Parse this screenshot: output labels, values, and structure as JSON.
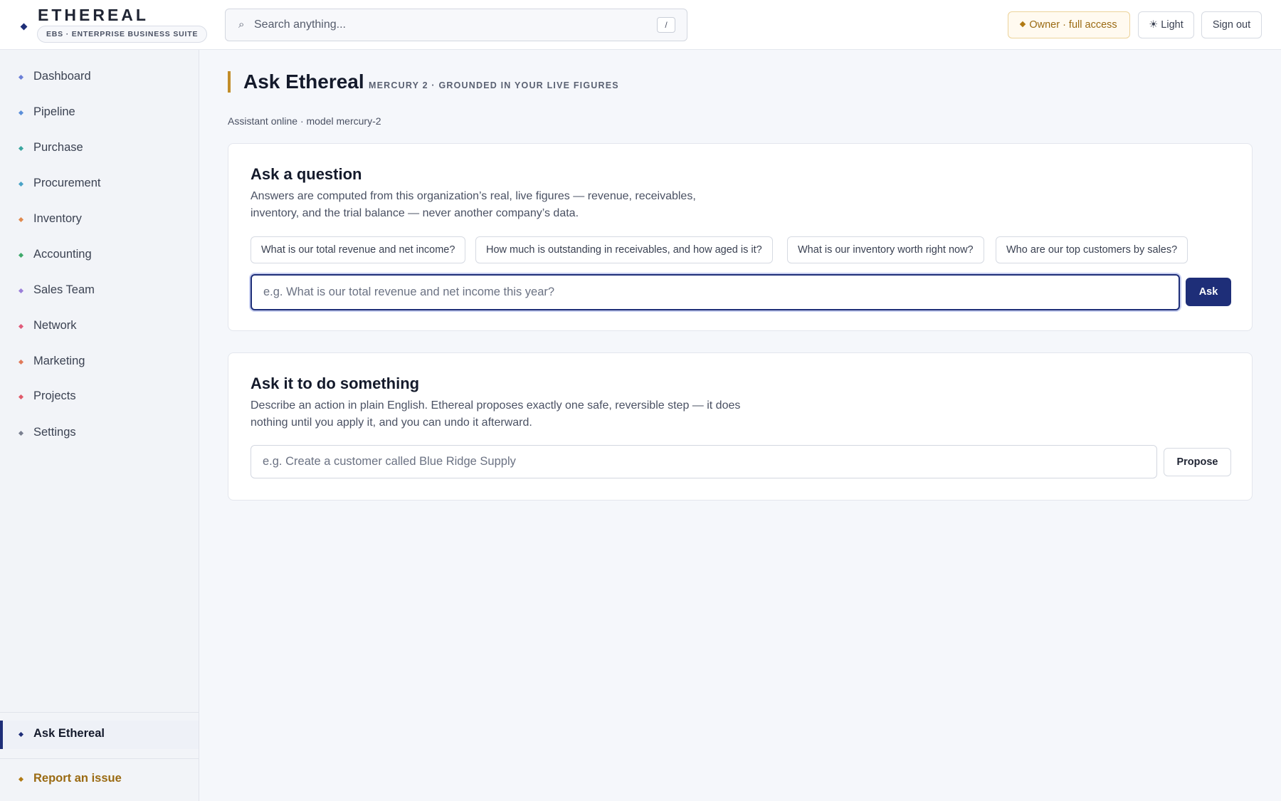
{
  "brand": {
    "name": "ETHEREAL",
    "tagline": "EBS · ENTERPRISE BUSINESS SUITE"
  },
  "search": {
    "placeholder": "Search anything...",
    "shortcut": "/"
  },
  "header_actions": {
    "role_label": "Owner · full access",
    "theme_label": "☀ Light",
    "signout_label": "Sign out"
  },
  "sidebar": {
    "items": [
      {
        "label": "Dashboard",
        "dot_color": "#6b7fd7"
      },
      {
        "label": "Pipeline",
        "dot_color": "#5b8fd9"
      },
      {
        "label": "Purchase",
        "dot_color": "#3aa6a0"
      },
      {
        "label": "Procurement",
        "dot_color": "#4aa3c7"
      },
      {
        "label": "Inventory",
        "dot_color": "#e08a4e"
      },
      {
        "label": "Accounting",
        "dot_color": "#3fa96b"
      },
      {
        "label": "Sales Team",
        "dot_color": "#9b7fd9"
      },
      {
        "label": "Network",
        "dot_color": "#e05a7a"
      },
      {
        "label": "Marketing",
        "dot_color": "#e07a5a"
      },
      {
        "label": "Projects",
        "dot_color": "#e05a6a"
      },
      {
        "label": "Settings",
        "dot_color": "#7a8090"
      }
    ],
    "active_item": {
      "label": "Ask Ethereal",
      "dot_color": "#1e2e78"
    },
    "report_item": {
      "label": "Report an issue",
      "dot_color": "#b07a14"
    }
  },
  "main": {
    "title": "Ask Ethereal",
    "subtitle": "MERCURY 2 · GROUNDED IN YOUR LIVE FIGURES",
    "status": "Assistant online · model mercury-2",
    "ask_card": {
      "title": "Ask a question",
      "description": "Answers are computed from this organization’s real, live figures — revenue, receivables, inventory, and the trial balance — never another company’s data.",
      "suggestions": [
        "What is our total revenue and net income?",
        "How much is outstanding in receivables, and how aged is it?",
        "What is our inventory worth right now?",
        "Who are our top customers by sales?"
      ],
      "input_placeholder": "e.g. What is our total revenue and net income this year?",
      "button_label": "Ask"
    },
    "do_card": {
      "title": "Ask it to do something",
      "description": "Describe an action in plain English. Ethereal proposes exactly one safe, reversible step — it does nothing until you apply it, and you can undo it afterward.",
      "input_placeholder": "e.g. Create a customer called Blue Ridge Supply",
      "button_label": "Propose"
    }
  },
  "colors": {
    "accent": "#1e2e78",
    "gold": "#c28d2a",
    "background": "#f5f7fb"
  }
}
